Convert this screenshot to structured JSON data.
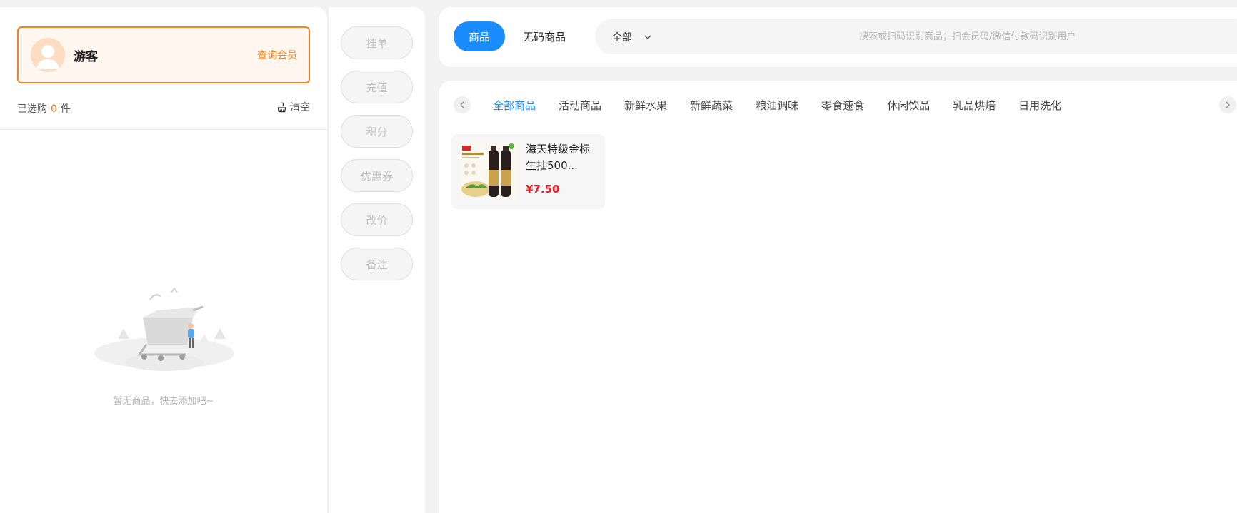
{
  "member": {
    "name": "游客",
    "query_label": "查询会员"
  },
  "cart": {
    "selected_prefix": "已选购",
    "selected_count": "0",
    "selected_suffix": "件",
    "clear_label": "清空",
    "empty_text": "暂无商品，快去添加吧~"
  },
  "actions": [
    {
      "label": "挂单"
    },
    {
      "label": "充值"
    },
    {
      "label": "积分"
    },
    {
      "label": "优惠券"
    },
    {
      "label": "改价"
    },
    {
      "label": "备注"
    }
  ],
  "top_tabs": {
    "goods": "商品",
    "no_code_goods": "无码商品"
  },
  "search": {
    "scope": "全部",
    "placeholder": "搜索或扫码识别商品；扫会员码/微信付款码识别用户"
  },
  "categories": [
    {
      "label": "全部商品",
      "active": true
    },
    {
      "label": "活动商品"
    },
    {
      "label": "新鲜水果"
    },
    {
      "label": "新鲜蔬菜"
    },
    {
      "label": "粮油调味"
    },
    {
      "label": "零食速食"
    },
    {
      "label": "休闲饮品"
    },
    {
      "label": "乳品烘焙"
    },
    {
      "label": "日用洗化"
    }
  ],
  "products": [
    {
      "name": "海天特级金标生抽500...",
      "price": "¥7.50"
    }
  ],
  "colors": {
    "accent": "#1a8cfe",
    "member_orange": "#f5821f",
    "price_red": "#e8212b"
  }
}
